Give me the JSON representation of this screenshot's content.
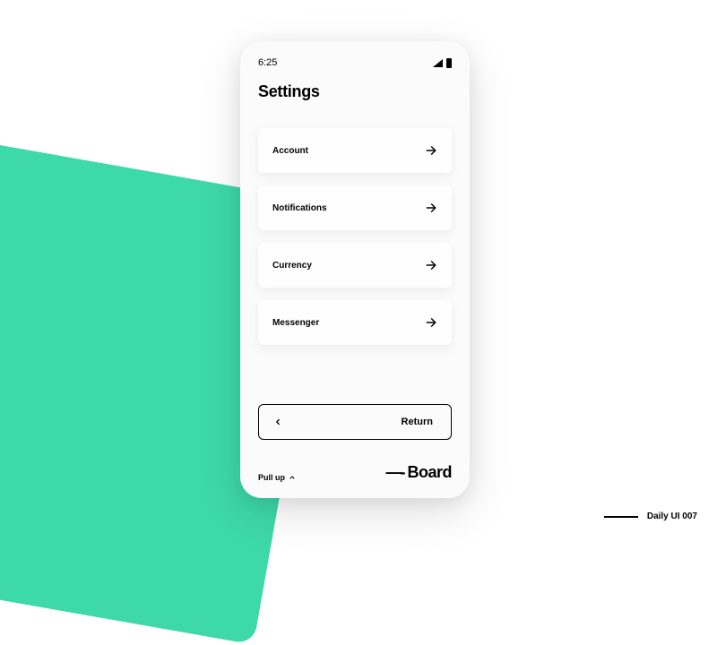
{
  "status": {
    "time": "6:25"
  },
  "title": "Settings",
  "items": [
    {
      "label": "Account"
    },
    {
      "label": "Notifications"
    },
    {
      "label": "Currency"
    },
    {
      "label": "Messenger"
    }
  ],
  "return_label": "Return",
  "pull_up_label": "Pull up",
  "brand": {
    "prefix": "—-",
    "name": "Board"
  },
  "footer": "Daily UI 007",
  "colors": {
    "accent": "#3ed9a8"
  }
}
